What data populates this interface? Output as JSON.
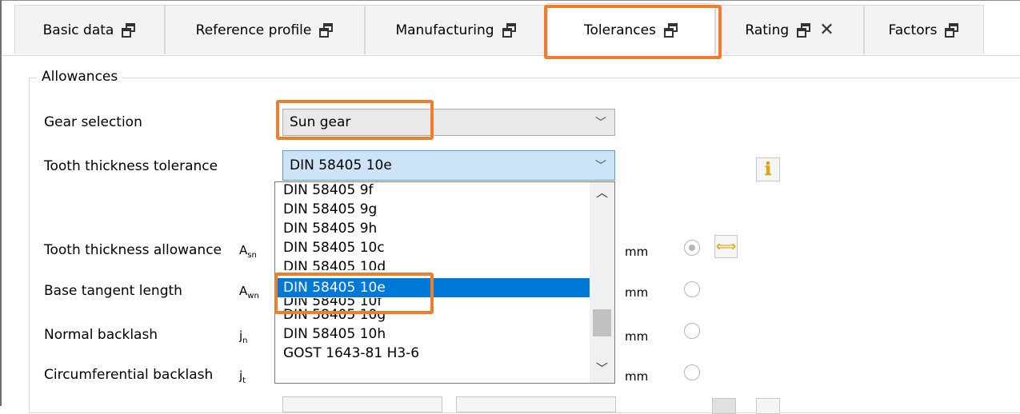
{
  "tabs": [
    {
      "label": "Basic data"
    },
    {
      "label": "Reference profile"
    },
    {
      "label": "Manufacturing"
    },
    {
      "label": "Tolerances"
    },
    {
      "label": "Rating"
    },
    {
      "label": "Factors"
    }
  ],
  "group": {
    "title": "Allowances"
  },
  "gear_selection": {
    "label": "Gear selection",
    "value": "Sun gear"
  },
  "tooth_thickness_tolerance": {
    "label": "Tooth thickness tolerance",
    "value": "DIN 58405 10e"
  },
  "rows": [
    {
      "label": "Tooth thickness allowance",
      "symbol_main": "A",
      "symbol_sub": "sn",
      "unit": "mm"
    },
    {
      "label": "Base tangent length",
      "symbol_main": "A",
      "symbol_sub": "wn",
      "unit": "mm"
    },
    {
      "label": "Normal backlash",
      "symbol_main": "j",
      "symbol_sub": "n",
      "unit": "mm"
    },
    {
      "label": "Circumferential backlash",
      "symbol_main": "j",
      "symbol_sub": "t",
      "unit": "mm"
    }
  ],
  "dropdown_options": [
    "DIN 58405 9f",
    "DIN 58405 9g",
    "DIN 58405 9h",
    "DIN 58405 10c",
    "DIN 58405 10d",
    "DIN 58405 10e",
    "DIN 58405 10f",
    "DIN 58405 10g",
    "DIN 58405 10h",
    "GOST 1643-81 H3-6"
  ],
  "dropdown_selected": "DIN 58405 10e",
  "icons": {
    "info": "i",
    "swap": "⟺"
  },
  "colors": {
    "highlight": "#ee7d2c",
    "selection": "#0078d7",
    "combo_focus": "#cce4f7"
  }
}
